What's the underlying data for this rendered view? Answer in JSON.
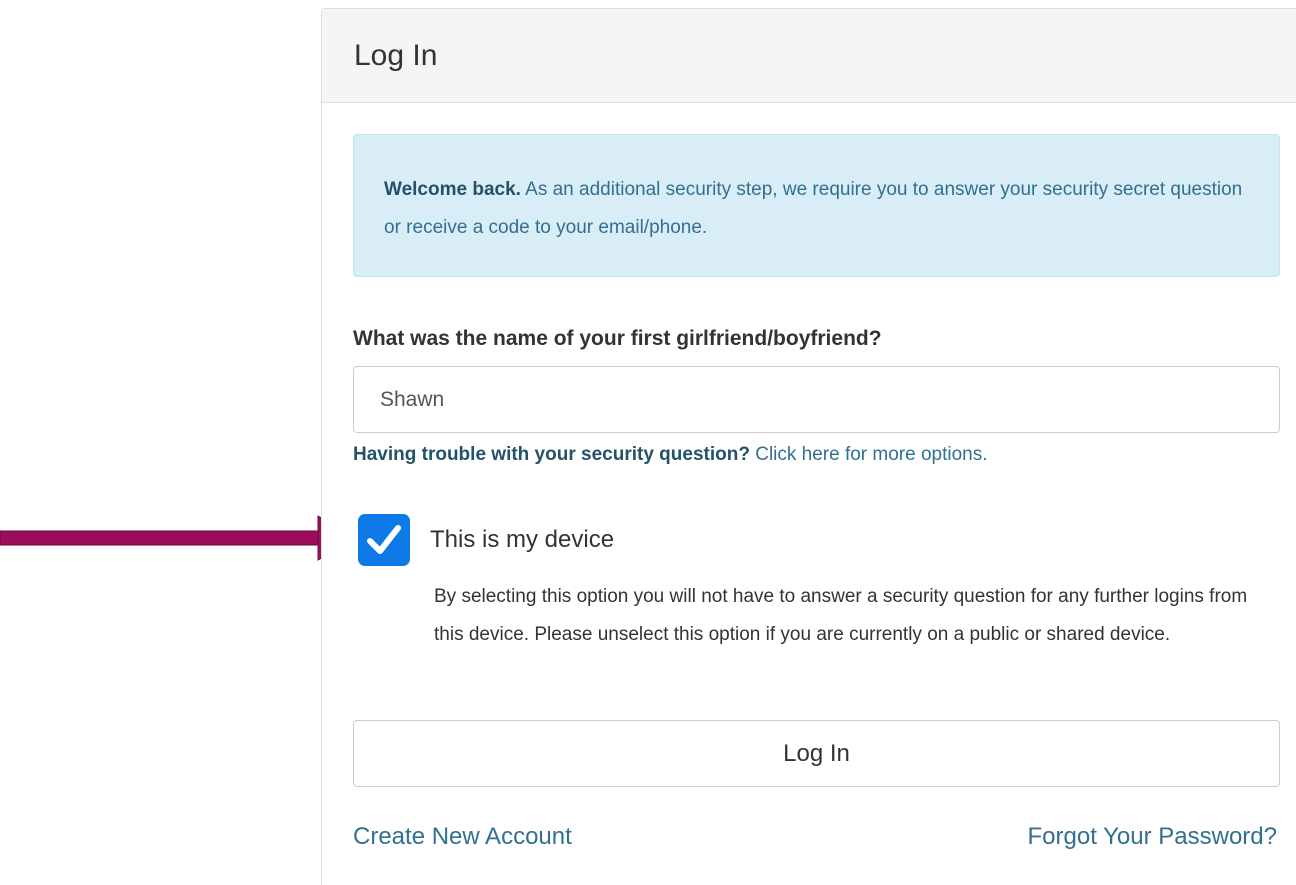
{
  "panel": {
    "title": "Log In"
  },
  "alert": {
    "strong": "Welcome back.",
    "text": " As an additional security step, we require you to answer your security secret question or receive a code to your email/phone."
  },
  "security_question": {
    "label": "What was the name of your first girlfriend/boyfriend?",
    "answer_value": "Shawn",
    "help_strong": "Having trouble with your security question?",
    "help_link": " Click here for more options."
  },
  "device": {
    "checked": true,
    "label": "This is my device",
    "description": "By selecting this option you will not have to answer a security question for any further logins from this device. Please unselect this option if you are currently on a public or shared device."
  },
  "actions": {
    "login_label": "Log In",
    "create_account": "Create New Account",
    "forgot_password": "Forgot Your Password?"
  },
  "icons": {
    "arrow": "right-arrow-icon",
    "check": "checkmark-icon"
  },
  "colors": {
    "arrow": "#9b0d5a",
    "checkbox": "#0d7ae8",
    "alert_bg": "#d9edf7",
    "link": "#31708f"
  }
}
